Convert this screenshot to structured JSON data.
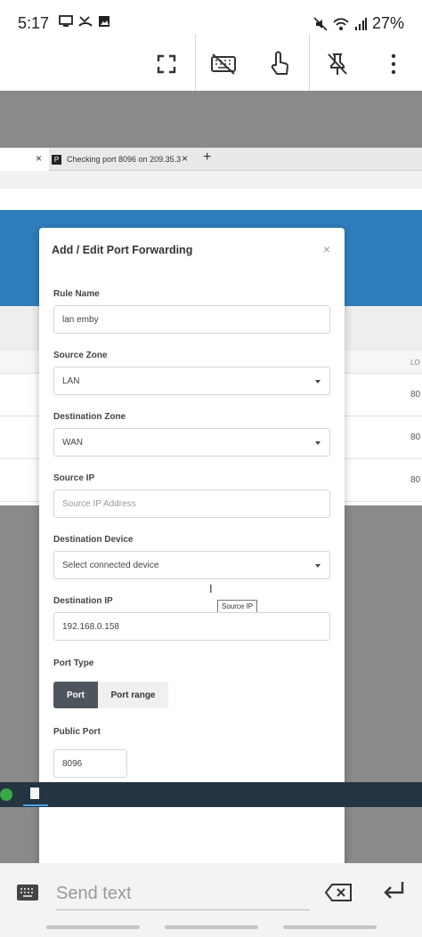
{
  "status_bar": {
    "time": "5:17",
    "battery": "27%",
    "left_icons": [
      "monitor-icon",
      "missed-call-icon",
      "image-icon"
    ],
    "right_icons": [
      "mute-icon",
      "wifi-icon",
      "signal-icon"
    ]
  },
  "rd_toolbar": {
    "icons": [
      "fullscreen-icon",
      "keyboard-off-icon",
      "touch-icon",
      "unpin-icon",
      "more-icon"
    ]
  },
  "browser": {
    "tab_close": "×",
    "tab2_favicon": "P",
    "tab2_title": "Checking port 8096 on 209.35.3",
    "new_tab": "+"
  },
  "background_page": {
    "col_label": "LO",
    "row_values": [
      "80",
      "80",
      "80"
    ]
  },
  "modal": {
    "title": "Add / Edit Port Forwarding",
    "close": "×",
    "fields": {
      "rule_name": {
        "label": "Rule Name",
        "value": "lan emby"
      },
      "source_zone": {
        "label": "Source Zone",
        "value": "LAN"
      },
      "destination_zone": {
        "label": "Destination Zone",
        "value": "WAN"
      },
      "source_ip": {
        "label": "Source IP",
        "placeholder": "Source IP Address",
        "tooltip": "Source IP"
      },
      "destination_device": {
        "label": "Destination Device",
        "placeholder": "Select connected device"
      },
      "destination_ip": {
        "label": "Destination IP",
        "value": "192.168.0.158"
      },
      "port_type": {
        "label": "Port Type",
        "options": [
          "Port",
          "Port range"
        ],
        "selected": "Port"
      },
      "public_port": {
        "label": "Public Port",
        "value": "8096"
      }
    }
  },
  "bottom_bar": {
    "placeholder": "Send text"
  }
}
